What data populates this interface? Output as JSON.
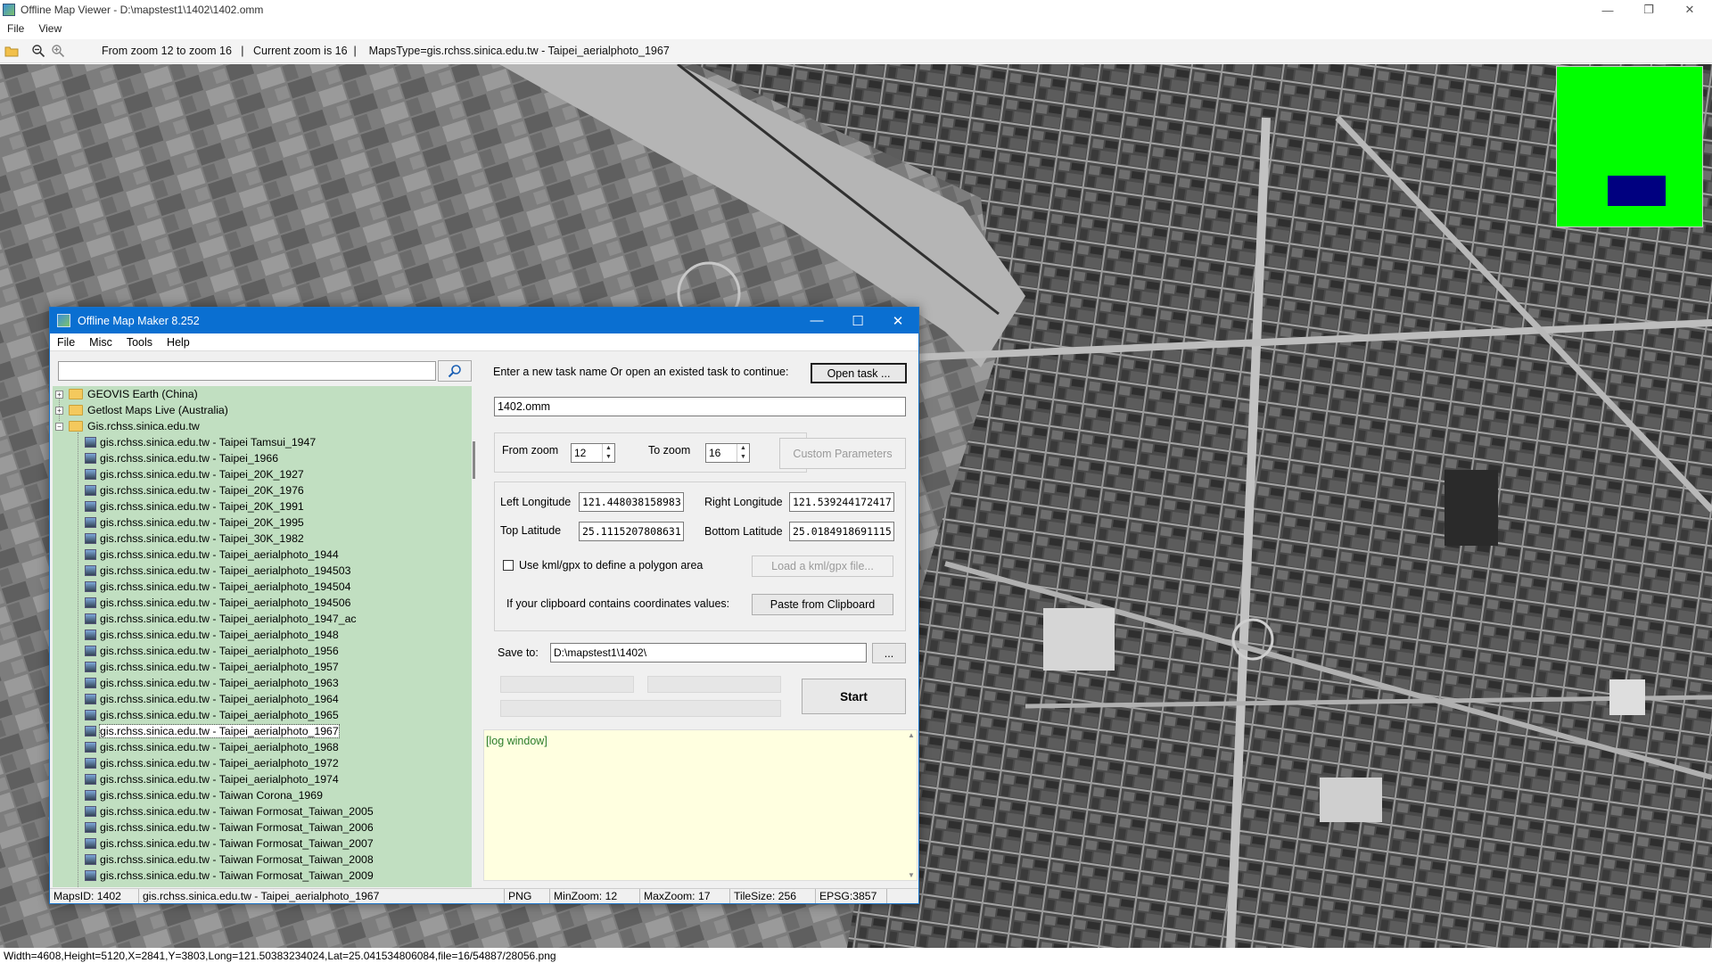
{
  "window": {
    "title": "Offline Map Viewer - D:\\mapstest1\\1402\\1402.omm",
    "menu": [
      "File",
      "View"
    ]
  },
  "toolbar": {
    "icons": [
      "open-folder-icon",
      "zoom-out-icon",
      "zoom-in-icon"
    ],
    "info": "From zoom 12 to zoom 16   |   Current zoom is 16  |    MapsType=gis.rchss.sinica.edu.tw - Taipei_aerialphoto_1967"
  },
  "status": "Width=4608,Height=5120,X=2841,Y=3803,Long=121.50383234024,Lat=25.041534806084,file=16/54887/28056.png",
  "colors": {
    "minimap_bg": "#00ff00",
    "minimap_view": "#000080",
    "dialog_title": "#0a6fd1",
    "tree_bg": "#c1dfc1",
    "log_bg": "#ffffe0"
  },
  "dialog": {
    "title": "Offline Map Maker 8.252",
    "menu": [
      "File",
      "Misc",
      "Tools",
      "Help"
    ],
    "search_value": "",
    "tree": {
      "groups": [
        {
          "label": "GEOVIS Earth (China)",
          "expanded": false
        },
        {
          "label": "Getlost Maps Live (Australia)",
          "expanded": false
        },
        {
          "label": "Gis.rchss.sinica.edu.tw",
          "expanded": true
        }
      ],
      "items": [
        "gis.rchss.sinica.edu.tw - Taipei Tamsui_1947",
        "gis.rchss.sinica.edu.tw - Taipei_1966",
        "gis.rchss.sinica.edu.tw - Taipei_20K_1927",
        "gis.rchss.sinica.edu.tw - Taipei_20K_1976",
        "gis.rchss.sinica.edu.tw - Taipei_20K_1991",
        "gis.rchss.sinica.edu.tw - Taipei_20K_1995",
        "gis.rchss.sinica.edu.tw - Taipei_30K_1982",
        "gis.rchss.sinica.edu.tw - Taipei_aerialphoto_1944",
        "gis.rchss.sinica.edu.tw - Taipei_aerialphoto_194503",
        "gis.rchss.sinica.edu.tw - Taipei_aerialphoto_194504",
        "gis.rchss.sinica.edu.tw - Taipei_aerialphoto_194506",
        "gis.rchss.sinica.edu.tw - Taipei_aerialphoto_1947_ac",
        "gis.rchss.sinica.edu.tw - Taipei_aerialphoto_1948",
        "gis.rchss.sinica.edu.tw - Taipei_aerialphoto_1956",
        "gis.rchss.sinica.edu.tw - Taipei_aerialphoto_1957",
        "gis.rchss.sinica.edu.tw - Taipei_aerialphoto_1963",
        "gis.rchss.sinica.edu.tw - Taipei_aerialphoto_1964",
        "gis.rchss.sinica.edu.tw - Taipei_aerialphoto_1965",
        "gis.rchss.sinica.edu.tw - Taipei_aerialphoto_1967",
        "gis.rchss.sinica.edu.tw - Taipei_aerialphoto_1968",
        "gis.rchss.sinica.edu.tw - Taipei_aerialphoto_1972",
        "gis.rchss.sinica.edu.tw - Taipei_aerialphoto_1974",
        "gis.rchss.sinica.edu.tw - Taiwan Corona_1969",
        "gis.rchss.sinica.edu.tw - Taiwan Formosat_Taiwan_2005",
        "gis.rchss.sinica.edu.tw - Taiwan Formosat_Taiwan_2006",
        "gis.rchss.sinica.edu.tw - Taiwan Formosat_Taiwan_2007",
        "gis.rchss.sinica.edu.tw - Taiwan Formosat_Taiwan_2008",
        "gis.rchss.sinica.edu.tw - Taiwan Formosat_Taiwan_2009"
      ],
      "selected": "gis.rchss.sinica.edu.tw - Taipei_aerialphoto_1967"
    },
    "task_prompt": "Enter a new task name Or open an existed task to continue:",
    "open_task_label": "Open task ...",
    "task_name": "1402.omm",
    "from_zoom_label": "From zoom",
    "from_zoom": "12",
    "to_zoom_label": "To zoom",
    "to_zoom": "16",
    "custom_params_label": "Custom Parameters",
    "left_lon_label": "Left Longitude",
    "left_lon": "121.448038158983",
    "right_lon_label": "Right Longitude",
    "right_lon": "121.539244172417",
    "top_lat_label": "Top Latitude",
    "top_lat": "25.1115207808631",
    "bottom_lat_label": "Bottom Latitude",
    "bottom_lat": "25.0184918691115",
    "kml_label": "Use kml/gpx to define a polygon area",
    "kml_checked": false,
    "load_kml_label": "Load a kml/gpx file...",
    "clipboard_prompt": "If your clipboard contains coordinates values:",
    "paste_label": "Paste from Clipboard",
    "save_to_label": "Save to:",
    "save_to": "D:\\mapstest1\\1402\\",
    "browse_label": "...",
    "start_label": "Start",
    "log_text": "[log window]",
    "statusbar": {
      "maps_id": "MapsID: 1402",
      "map_type": "gis.rchss.sinica.edu.tw - Taipei_aerialphoto_1967",
      "format": "PNG",
      "min_zoom": "MinZoom: 12",
      "max_zoom": "MaxZoom: 17",
      "tile_size": "TileSize: 256",
      "epsg": "EPSG:3857"
    }
  }
}
